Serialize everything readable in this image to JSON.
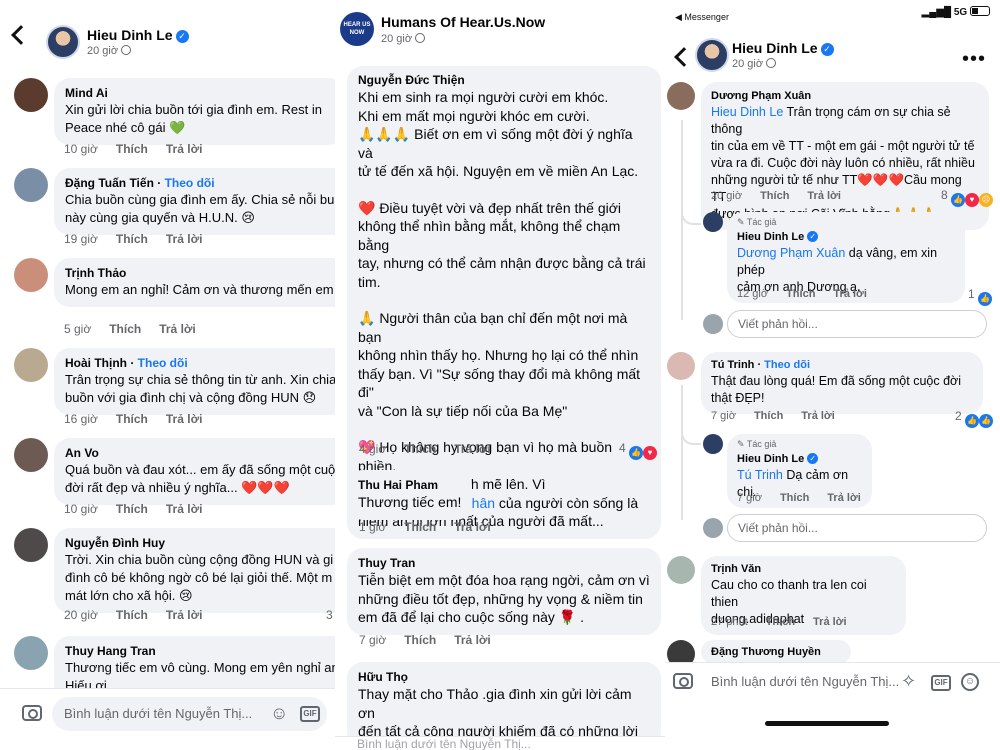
{
  "panel1": {
    "header": {
      "name": "Hieu Dinh Le",
      "time": "20 giờ"
    },
    "comments": [
      {
        "name": "Mind Ai",
        "text": "Xin gửi lời chia buồn tới gia đình em. Rest in\nPeace nhé cô gái 💚",
        "time": "10 giờ"
      },
      {
        "name": "Đặng Tuấn Tiến",
        "follow": "Theo dõi",
        "text": "Chia buồn cùng gia đình em ấy. Chia sẻ nỗi bu\nnày cùng gia quyến và H.U.N. 😢",
        "time": "19 giờ"
      },
      {
        "name": "Trịnh Thảo",
        "text": "Mong em an nghỉ! Cảm ơn và thương mến em",
        "time": "5 giờ"
      },
      {
        "name": "Hoài Thịnh",
        "follow": "Theo dõi",
        "text": "Trân trọng sự chia sẻ thông tin từ anh. Xin chia\nbuồn với gia đình chị và cộng đồng HUN 😞",
        "time": "16 giờ"
      },
      {
        "name": "An Vo",
        "text": "Quá buồn và đau xót... em ấy đã sống một cuộ\nđời rất đẹp và nhiều ý nghĩa... ❤️❤️❤️",
        "time": "10 giờ"
      },
      {
        "name": "Nguyễn Đình Huy",
        "text": "Trời. Xin chia buồn cùng cộng đồng HUN và gi\nđình cô bé không ngờ cô bé lại giỏi thế. Một m\nmát lớn cho xã hội. 😢",
        "time": "20 giờ",
        "count": "3"
      },
      {
        "name": "Thuy Hang Tran",
        "text": "Thương tiếc em vô cùng. Mong em yên nghỉ an\nHiếu ơi",
        "time": ""
      }
    ],
    "like": "Thích",
    "reply": "Trả lời",
    "input_placeholder": "Bình luận dưới tên Nguyễn Thị..."
  },
  "panel2": {
    "header": {
      "name": "Humans Of Hear.Us.Now",
      "time": "20 giờ",
      "logo_text": "HEAR US NOW"
    },
    "main_comment": {
      "name": "Nguyễn Đức Thiện",
      "p1": "Khi em sinh ra mọi người cười em khóc.\nKhi em mất mọi người khóc em cười.\n🙏🙏🙏 Biết ơn em vì sống một đời ý nghĩa và\ntử tế đến xã hội. Nguyện em về miền An Lạc.",
      "p2": "❤️ Điều tuyệt vời và đẹp nhất trên thế giới\nkhông thể nhìn bằng mắt, không thể chạm bằng\ntay, nhưng có thể cảm nhận được bằng cả trái\ntim.",
      "p3": "🙏 Người thân của bạn chỉ đến một nơi mà bạn\nkhông nhìn thấy họ. Nhưng họ lại có thể nhìn\nthấy bạn. Vì \"Sự sống thay đổi mà không mất đi\"\nvà \"Con là sự tiếp nối của Ba Mẹ\"",
      "p4a": "💖 Họ không hy vọng bạn vì họ mà buồn phiền,\nkhóc lóc, hãy mạnh mẽ lên. Vì\n",
      "hashtag": "#Hạnh_Phúc_tự_thân",
      "p4b": " của người còn sống là\nniềm an ủi lớn nhất của người đã mất...",
      "time": "4 giờ",
      "count": "4"
    },
    "comments": [
      {
        "name": "Thu Hai Pham",
        "text": "Thương tiếc em!",
        "time": "1 giờ"
      },
      {
        "name": "Thuy Tran",
        "text": "Tiễn biệt em một đóa hoa rạng ngời, cảm ơn vì\nnhững điều tốt đẹp, những hy vọng & niềm tin\nem đã để lại cho cuộc sống này 🌹 .",
        "time": "7 giờ"
      },
      {
        "name": "Hữu Thọ",
        "text": "Thay mặt cho Thảo .gia đình xin gửi lời cảm ơn\nđến tất cả cộng người khiếm đã có những lời",
        "time": ""
      }
    ],
    "like": "Thích",
    "reply": "Trả lời",
    "input_placeholder": "Bình luận dưới tên Nguyễn Thị..."
  },
  "panel3": {
    "status": {
      "left": "◀ Messenger",
      "right": "5G"
    },
    "header": {
      "name": "Hieu Dinh Le",
      "time": "20 giờ"
    },
    "c1": {
      "name": "Dương Phạm Xuân",
      "mention": "Hieu Dinh Le",
      "text": " Trân trọng cám ơn sự chia sẻ thông\ntin của em về TT - một em gái - một người tử tế\nvừa ra đi. Cuộc đời này luôn có nhiều, rất nhiều\nnhững người tử tế như TT❤️❤️❤️Cầu mong TT\nđược bình an nơi Cõi Vĩnh hằng🙏🙏🙏",
      "time": "20 giờ",
      "count": "8"
    },
    "r1": {
      "author_tag": "Tác giả",
      "name": "Hieu Dinh Le",
      "mention": "Dương Phạm Xuân",
      "text": " dạ vâng, em xin phép\ncảm ơn anh Dương ạ.",
      "time": "12 giờ",
      "count": "1"
    },
    "c2": {
      "name": "Tú Trinh",
      "follow": "Theo dõi",
      "text": "Thật đau lòng quá! Em đã sống một cuộc đời\nthật ĐẸP!",
      "time": "7 giờ",
      "count": "2"
    },
    "r2": {
      "author_tag": "Tác giả",
      "name": "Hieu Dinh Le",
      "mention": "Tú Trinh",
      "text": " Dạ cảm ơn chị.",
      "time": "7 giờ"
    },
    "c3": {
      "name": "Trịnh Văn",
      "text": "Cau cho co thanh tra len coi thien\nduong.adidaphat",
      "time": "27 phút"
    },
    "c4": {
      "name": "Đặng Thương Huyền"
    },
    "reply_placeholder": "Viết phản hồi...",
    "like": "Thích",
    "reply": "Trả lời",
    "input_placeholder": "Bình luận dưới tên Nguyễn Thị..."
  }
}
